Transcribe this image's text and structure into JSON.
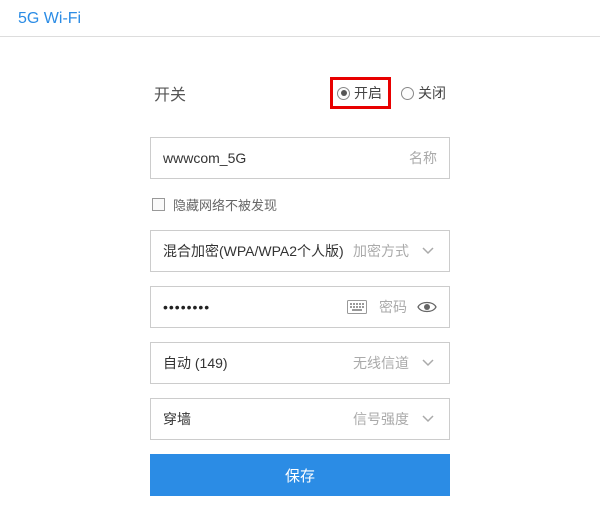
{
  "header": {
    "title": "5G Wi-Fi"
  },
  "switch": {
    "label": "开关",
    "on": "开启",
    "off": "关闭",
    "value": "on"
  },
  "ssid": {
    "value": "wwwcom_5G",
    "label": "名称"
  },
  "hide": {
    "label": "隐藏网络不被发现",
    "checked": false
  },
  "encryption": {
    "value": "混合加密(WPA/WPA2个人版)",
    "label": "加密方式"
  },
  "password": {
    "value": "••••••••",
    "label": "密码"
  },
  "channel": {
    "value": "自动 (149)",
    "label": "无线信道"
  },
  "strength": {
    "value": "穿墙",
    "label": "信号强度"
  },
  "save": {
    "label": "保存"
  },
  "colors": {
    "accent": "#2b8ce5",
    "highlight": "#e80000"
  }
}
